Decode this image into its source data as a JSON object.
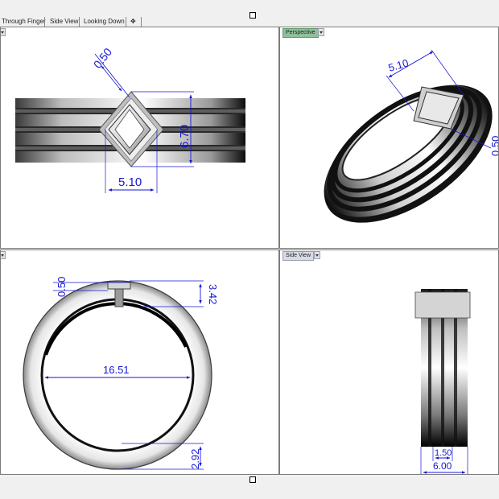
{
  "tabs": [
    {
      "label": "Through Finger"
    },
    {
      "label": "Side View"
    },
    {
      "label": "Looking Down"
    }
  ],
  "add_tab_icon": "plus-in-diamond-icon",
  "viewports": {
    "top_left": {
      "label": "",
      "dims": {
        "a": "0.50",
        "b": "6.70",
        "c": "5.10"
      }
    },
    "perspective": {
      "label": "Perspective",
      "dims": {
        "a": "5.10",
        "b": "0.50"
      }
    },
    "bottom_left": {
      "label": "",
      "dims": {
        "a": "0.50",
        "b": "3.42",
        "c": "16.51",
        "d": "2.92"
      }
    },
    "side_view": {
      "label": "Side View",
      "dims": {
        "a": "1.50",
        "b": "6.00"
      }
    }
  },
  "colors": {
    "dimension": "#1616d8",
    "active_viewport": "#8fc09a"
  }
}
